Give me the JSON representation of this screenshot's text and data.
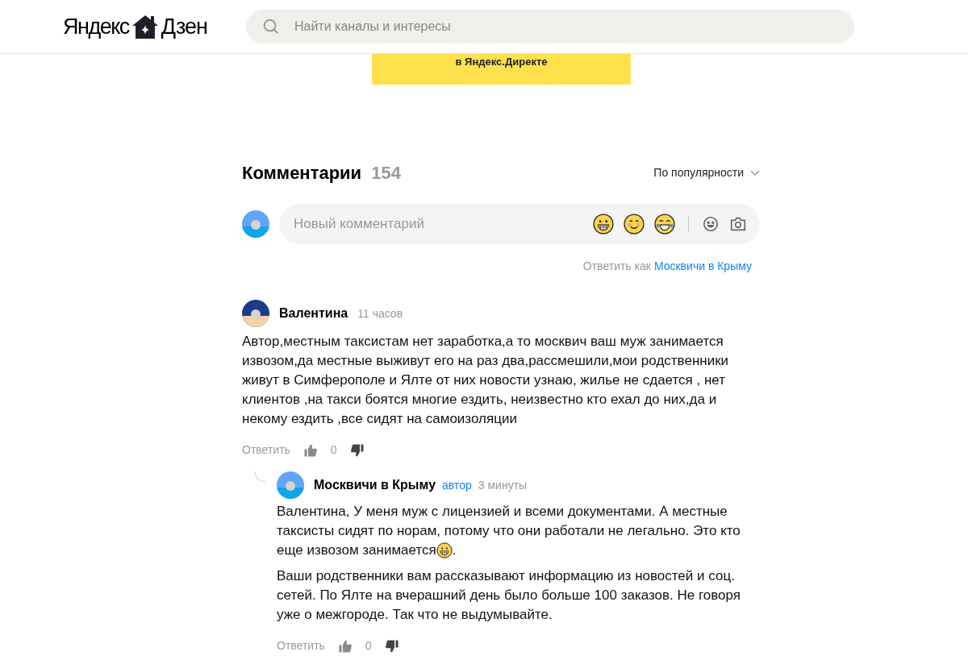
{
  "header": {
    "logo": {
      "left": "Яндекс",
      "right": "Дзен"
    },
    "search": {
      "placeholder": "Найти каналы и интересы"
    }
  },
  "banner": {
    "text": "в Яндекс.Директе"
  },
  "comments_section": {
    "title": "Комментарии",
    "count": "154",
    "sort": "По популярности",
    "composer": {
      "placeholder": "Новый комментарий"
    },
    "reply_as": {
      "label": "Ответить как",
      "channel": "Москвичи в Крыму"
    }
  },
  "comments": [
    {
      "author": "Валентина",
      "time": "11 часов",
      "paragraphs": [
        [
          [
            {
              "kind": "text",
              "text": "Автор,местным таксистам нет заработка,а то москвич ваш муж занимается извозом,да местные выживут его на раз два,рассмешили,мои родственники живут в Симферополе и Ялте от них новости узнаю, жилье не сдается , нет клиентов ,на такси боятся многие ездить, неизвестно кто ехал до них,да и некому ездить ,все сидят на самоизоляции"
            }
          ]
        ]
      ],
      "reply_label": "Ответить",
      "likes": "0",
      "replies": [
        {
          "author": "Москвичи в Крыму",
          "badge": "автор",
          "time": "3 минуты",
          "paragraphs": [
            [
              [
                {
                  "kind": "text",
                  "text": "Валентина, У меня муж с лицензией и всеми документами. А местные таксисты сидят по норам, потому что они работали не легально. Это кто"
                }
              ],
              [
                {
                  "kind": "text",
                  "text": "еще извозом занимается"
                },
                {
                  "kind": "emoji"
                },
                {
                  "kind": "text",
                  "text": "."
                }
              ]
            ],
            [
              [
                {
                  "kind": "text",
                  "text": "Ваши родственники вам рассказывают информацию из новостей и соц. сетей. По Ялте на вчерашний день было больше 100 заказов. Не говоря уже о межгороде. Так что не выдумывайте."
                }
              ]
            ]
          ],
          "reply_label": "Ответить",
          "likes": "0"
        }
      ]
    }
  ]
}
